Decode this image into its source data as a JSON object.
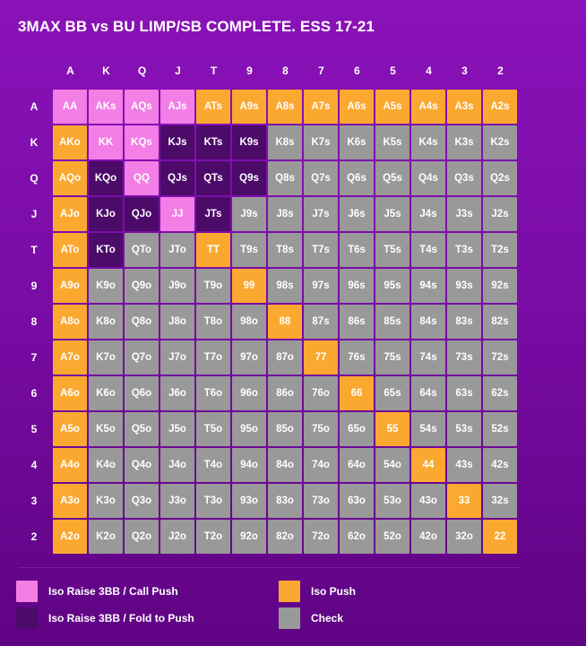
{
  "title": "3MAX BB vs BU LIMP/SB COMPLETE. ESS 17-21",
  "ranks": [
    "A",
    "K",
    "Q",
    "J",
    "T",
    "9",
    "8",
    "7",
    "6",
    "5",
    "4",
    "3",
    "2"
  ],
  "colors": {
    "P": "#f27ee6",
    "D": "#4c0a69",
    "O": "#fba830",
    "G": "#999999"
  },
  "grid": [
    {
      "label": "A",
      "cells": [
        [
          "AA",
          "P"
        ],
        [
          "AKs",
          "P"
        ],
        [
          "AQs",
          "P"
        ],
        [
          "AJs",
          "P"
        ],
        [
          "ATs",
          "O"
        ],
        [
          "A9s",
          "O"
        ],
        [
          "A8s",
          "O"
        ],
        [
          "A7s",
          "O"
        ],
        [
          "A6s",
          "O"
        ],
        [
          "A5s",
          "O"
        ],
        [
          "A4s",
          "O"
        ],
        [
          "A3s",
          "O"
        ],
        [
          "A2s",
          "O"
        ]
      ]
    },
    {
      "label": "K",
      "cells": [
        [
          "AKo",
          "O"
        ],
        [
          "KK",
          "P"
        ],
        [
          "KQs",
          "P"
        ],
        [
          "KJs",
          "D"
        ],
        [
          "KTs",
          "D"
        ],
        [
          "K9s",
          "D"
        ],
        [
          "K8s",
          "G"
        ],
        [
          "K7s",
          "G"
        ],
        [
          "K6s",
          "G"
        ],
        [
          "K5s",
          "G"
        ],
        [
          "K4s",
          "G"
        ],
        [
          "K3s",
          "G"
        ],
        [
          "K2s",
          "G"
        ]
      ]
    },
    {
      "label": "Q",
      "cells": [
        [
          "AQo",
          "O"
        ],
        [
          "KQo",
          "D"
        ],
        [
          "QQ",
          "P"
        ],
        [
          "QJs",
          "D"
        ],
        [
          "QTs",
          "D"
        ],
        [
          "Q9s",
          "D"
        ],
        [
          "Q8s",
          "G"
        ],
        [
          "Q7s",
          "G"
        ],
        [
          "Q6s",
          "G"
        ],
        [
          "Q5s",
          "G"
        ],
        [
          "Q4s",
          "G"
        ],
        [
          "Q3s",
          "G"
        ],
        [
          "Q2s",
          "G"
        ]
      ]
    },
    {
      "label": "J",
      "cells": [
        [
          "AJo",
          "O"
        ],
        [
          "KJo",
          "D"
        ],
        [
          "QJo",
          "D"
        ],
        [
          "JJ",
          "P"
        ],
        [
          "JTs",
          "D"
        ],
        [
          "J9s",
          "G"
        ],
        [
          "J8s",
          "G"
        ],
        [
          "J7s",
          "G"
        ],
        [
          "J6s",
          "G"
        ],
        [
          "J5s",
          "G"
        ],
        [
          "J4s",
          "G"
        ],
        [
          "J3s",
          "G"
        ],
        [
          "J2s",
          "G"
        ]
      ]
    },
    {
      "label": "T",
      "cells": [
        [
          "ATo",
          "O"
        ],
        [
          "KTo",
          "D"
        ],
        [
          "QTo",
          "G"
        ],
        [
          "JTo",
          "G"
        ],
        [
          "TT",
          "O"
        ],
        [
          "T9s",
          "G"
        ],
        [
          "T8s",
          "G"
        ],
        [
          "T7s",
          "G"
        ],
        [
          "T6s",
          "G"
        ],
        [
          "T5s",
          "G"
        ],
        [
          "T4s",
          "G"
        ],
        [
          "T3s",
          "G"
        ],
        [
          "T2s",
          "G"
        ]
      ]
    },
    {
      "label": "9",
      "cells": [
        [
          "A9o",
          "O"
        ],
        [
          "K9o",
          "G"
        ],
        [
          "Q9o",
          "G"
        ],
        [
          "J9o",
          "G"
        ],
        [
          "T9o",
          "G"
        ],
        [
          "99",
          "O"
        ],
        [
          "98s",
          "G"
        ],
        [
          "97s",
          "G"
        ],
        [
          "96s",
          "G"
        ],
        [
          "95s",
          "G"
        ],
        [
          "94s",
          "G"
        ],
        [
          "93s",
          "G"
        ],
        [
          "92s",
          "G"
        ]
      ]
    },
    {
      "label": "8",
      "cells": [
        [
          "A8o",
          "O"
        ],
        [
          "K8o",
          "G"
        ],
        [
          "Q8o",
          "G"
        ],
        [
          "J8o",
          "G"
        ],
        [
          "T8o",
          "G"
        ],
        [
          "98o",
          "G"
        ],
        [
          "88",
          "O"
        ],
        [
          "87s",
          "G"
        ],
        [
          "86s",
          "G"
        ],
        [
          "85s",
          "G"
        ],
        [
          "84s",
          "G"
        ],
        [
          "83s",
          "G"
        ],
        [
          "82s",
          "G"
        ]
      ]
    },
    {
      "label": "7",
      "cells": [
        [
          "A7o",
          "O"
        ],
        [
          "K7o",
          "G"
        ],
        [
          "Q7o",
          "G"
        ],
        [
          "J7o",
          "G"
        ],
        [
          "T7o",
          "G"
        ],
        [
          "97o",
          "G"
        ],
        [
          "87o",
          "G"
        ],
        [
          "77",
          "O"
        ],
        [
          "76s",
          "G"
        ],
        [
          "75s",
          "G"
        ],
        [
          "74s",
          "G"
        ],
        [
          "73s",
          "G"
        ],
        [
          "72s",
          "G"
        ]
      ]
    },
    {
      "label": "6",
      "cells": [
        [
          "A6o",
          "O"
        ],
        [
          "K6o",
          "G"
        ],
        [
          "Q6o",
          "G"
        ],
        [
          "J6o",
          "G"
        ],
        [
          "T6o",
          "G"
        ],
        [
          "96o",
          "G"
        ],
        [
          "86o",
          "G"
        ],
        [
          "76o",
          "G"
        ],
        [
          "66",
          "O"
        ],
        [
          "65s",
          "G"
        ],
        [
          "64s",
          "G"
        ],
        [
          "63s",
          "G"
        ],
        [
          "62s",
          "G"
        ]
      ]
    },
    {
      "label": "5",
      "cells": [
        [
          "A5o",
          "O"
        ],
        [
          "K5o",
          "G"
        ],
        [
          "Q5o",
          "G"
        ],
        [
          "J5o",
          "G"
        ],
        [
          "T5o",
          "G"
        ],
        [
          "95o",
          "G"
        ],
        [
          "85o",
          "G"
        ],
        [
          "75o",
          "G"
        ],
        [
          "65o",
          "G"
        ],
        [
          "55",
          "O"
        ],
        [
          "54s",
          "G"
        ],
        [
          "53s",
          "G"
        ],
        [
          "52s",
          "G"
        ]
      ]
    },
    {
      "label": "4",
      "cells": [
        [
          "A4o",
          "O"
        ],
        [
          "K4o",
          "G"
        ],
        [
          "Q4o",
          "G"
        ],
        [
          "J4o",
          "G"
        ],
        [
          "T4o",
          "G"
        ],
        [
          "94o",
          "G"
        ],
        [
          "84o",
          "G"
        ],
        [
          "74o",
          "G"
        ],
        [
          "64o",
          "G"
        ],
        [
          "54o",
          "G"
        ],
        [
          "44",
          "O"
        ],
        [
          "43s",
          "G"
        ],
        [
          "42s",
          "G"
        ]
      ]
    },
    {
      "label": "3",
      "cells": [
        [
          "A3o",
          "O"
        ],
        [
          "K3o",
          "G"
        ],
        [
          "Q3o",
          "G"
        ],
        [
          "J3o",
          "G"
        ],
        [
          "T3o",
          "G"
        ],
        [
          "93o",
          "G"
        ],
        [
          "83o",
          "G"
        ],
        [
          "73o",
          "G"
        ],
        [
          "63o",
          "G"
        ],
        [
          "53o",
          "G"
        ],
        [
          "43o",
          "G"
        ],
        [
          "33",
          "O"
        ],
        [
          "32s",
          "G"
        ]
      ]
    },
    {
      "label": "2",
      "cells": [
        [
          "A2o",
          "O"
        ],
        [
          "K2o",
          "G"
        ],
        [
          "Q2o",
          "G"
        ],
        [
          "J2o",
          "G"
        ],
        [
          "T2o",
          "G"
        ],
        [
          "92o",
          "G"
        ],
        [
          "82o",
          "G"
        ],
        [
          "72o",
          "G"
        ],
        [
          "62o",
          "G"
        ],
        [
          "52o",
          "G"
        ],
        [
          "42o",
          "G"
        ],
        [
          "32o",
          "G"
        ],
        [
          "22",
          "O"
        ]
      ]
    }
  ],
  "legend": [
    {
      "label": "Iso Raise 3BB / Call Push",
      "color": "#f27ee6"
    },
    {
      "label": "Iso Push",
      "color": "#fba830"
    },
    {
      "label": "Iso Raise 3BB / Fold to Push",
      "color": "#4c0a69"
    },
    {
      "label": "Check",
      "color": "#999999"
    }
  ]
}
